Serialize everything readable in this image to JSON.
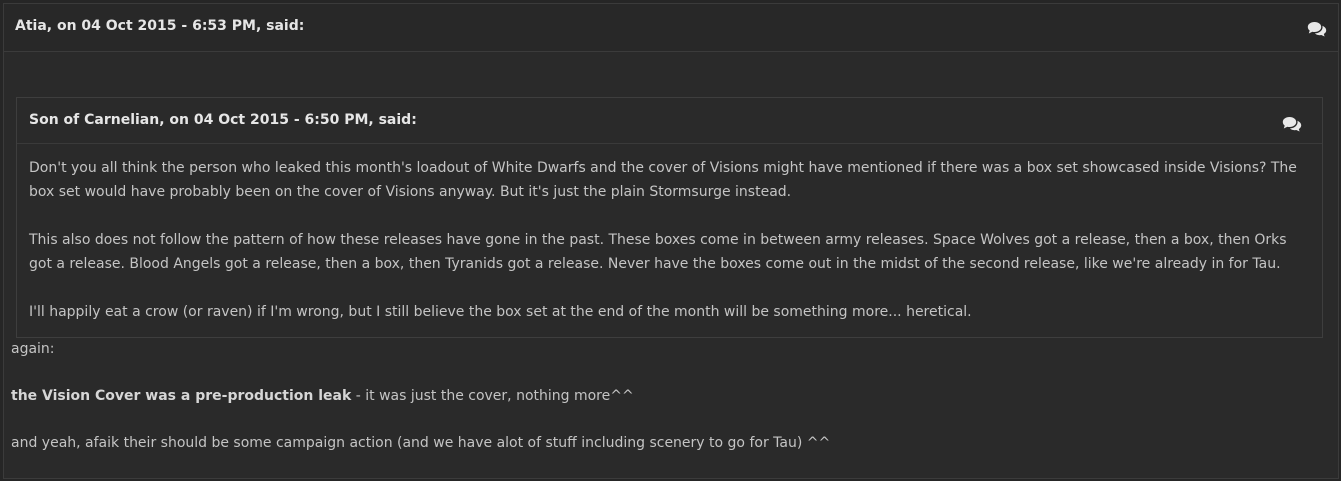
{
  "outer_quote": {
    "citation": "Atia, on 04 Oct 2015 - 6:53 PM, said:",
    "icon": "quote-bubbles-icon"
  },
  "inner_quote": {
    "citation": "Son of Carnelian, on 04 Oct 2015 - 6:50 PM, said:",
    "icon": "quote-bubbles-icon",
    "paragraphs": [
      "Don't you all think the person who leaked this month's loadout of White Dwarfs and the cover of Visions might have mentioned if there was a box set showcased inside Visions? The box set would have probably been on the cover of Visions anyway. But it's just the plain Stormsurge instead.",
      "This also does not follow the pattern of how these releases have gone in the past. These boxes come in between army releases. Space Wolves got a release, then a box, then Orks got a release. Blood Angels got a release, then a box, then Tyranids got a release. Never have the boxes come out in the midst of the second release, like we're already in for Tau.",
      "I'll happily eat a crow (or raven) if I'm wrong, but I still believe the box set at the end of the month will be something more... heretical."
    ]
  },
  "reply": {
    "line1": "again:",
    "line2_bold": "the Vision Cover was a pre-production leak",
    "line2_rest": " - it was just the cover, nothing more^^",
    "line3": "and yeah, afaik their should be some campaign action (and we have alot of stuff including scenery to go for Tau) ^^"
  }
}
